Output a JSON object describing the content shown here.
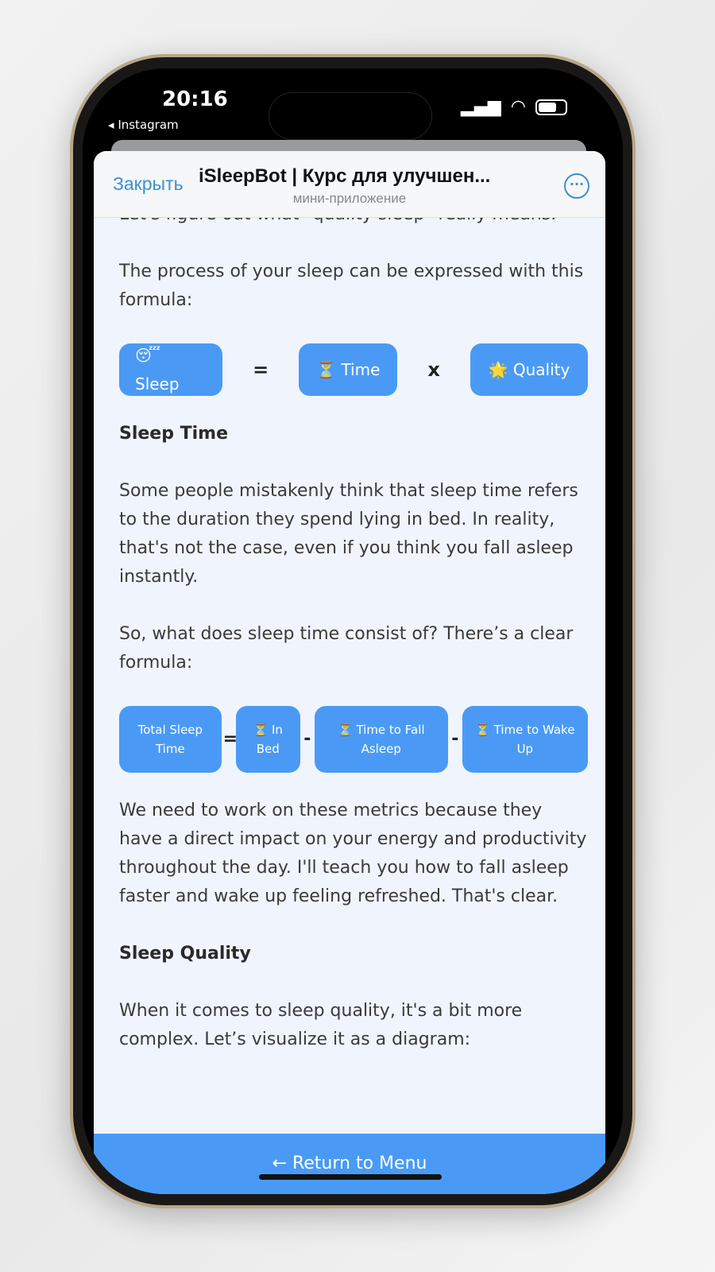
{
  "status": {
    "time": "20:16",
    "back_app": "Instagram"
  },
  "header": {
    "close": "Закрыть",
    "title": "iSleepBot | Курс для улучшен...",
    "subtitle": "мини-приложение",
    "more_icon": "ellipsis-circle-icon"
  },
  "content": {
    "p0": "Let's figure out what \"quality sleep\" really means.",
    "p1": "The process of your sleep can be expressed with this formula:",
    "formula1": {
      "a": "😴 Sleep",
      "eq": "=",
      "b": "⏳ Time",
      "x": "x",
      "c": "🌟 Quality"
    },
    "h1": "Sleep Time",
    "p2": "Some people mistakenly think that sleep time refers to the duration they spend lying in bed. In reality, that's not the case, even if you think you fall asleep instantly.",
    "p3": "So, what does sleep time consist of? There’s a clear formula:",
    "formula2": {
      "a": "Total Sleep Time",
      "eq": "=",
      "b": "⏳ In Bed",
      "m1": "-",
      "c": "⏳ Time to Fall Asleep",
      "m2": "-",
      "d": "⏳ Time to Wake Up"
    },
    "p4": "We need to work on these metrics because they have a direct impact on your energy and productivity throughout the day. I'll teach you how to fall asleep faster and wake up feeling refreshed. That's clear.",
    "h2": "Sleep Quality",
    "p5": "When it comes to sleep quality, it's a bit more complex. Let’s visualize it as a diagram:"
  },
  "bottom": {
    "label": "← Return to Menu"
  },
  "colors": {
    "accent": "#4a9af5",
    "link": "#3d8fd0"
  }
}
